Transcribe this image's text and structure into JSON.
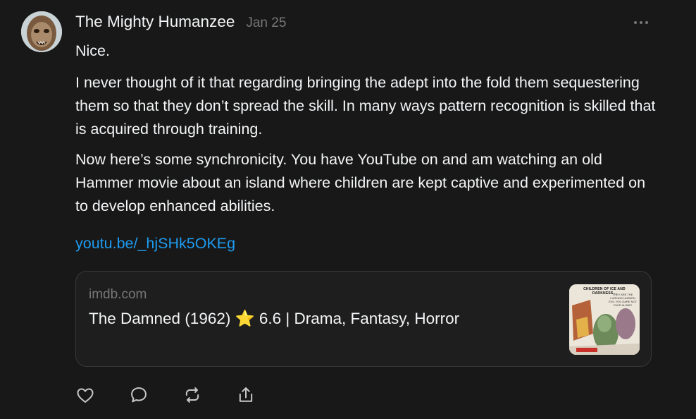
{
  "post": {
    "author": "The Mighty Humanzee",
    "date": "Jan 25",
    "paragraphs": [
      "Nice.",
      "I never thought of it that regarding bringing the adept into the fold them sequestering them so that they don’t spread the skill. In many ways pattern recognition is skilled that is acquired through training.",
      "Now here’s some synchronicity. You have YouTube on and am watching an old Hammer movie about an island where children are kept captive and experimented on to develop enhanced abilities."
    ],
    "link": "youtu.be/_hjSHk5OKEg"
  },
  "card": {
    "domain": "imdb.com",
    "title": "The Damned (1962) ⭐ 6.6 | Drama, Fantasy, Horror",
    "thumbnail": {
      "headline": "CHILDREN OF ICE AND DARKNESS...",
      "tagline": "THEY ARE THE LURKING UNSEEN EVIL YOU DARE NOT FACE ALONE!"
    }
  },
  "actions": [
    "heart-icon",
    "comment-icon",
    "repost-icon",
    "share-icon"
  ],
  "colors": {
    "background": "#181818",
    "text": "#f3f5f7",
    "muted": "#777777",
    "link": "#1d9bf0"
  }
}
